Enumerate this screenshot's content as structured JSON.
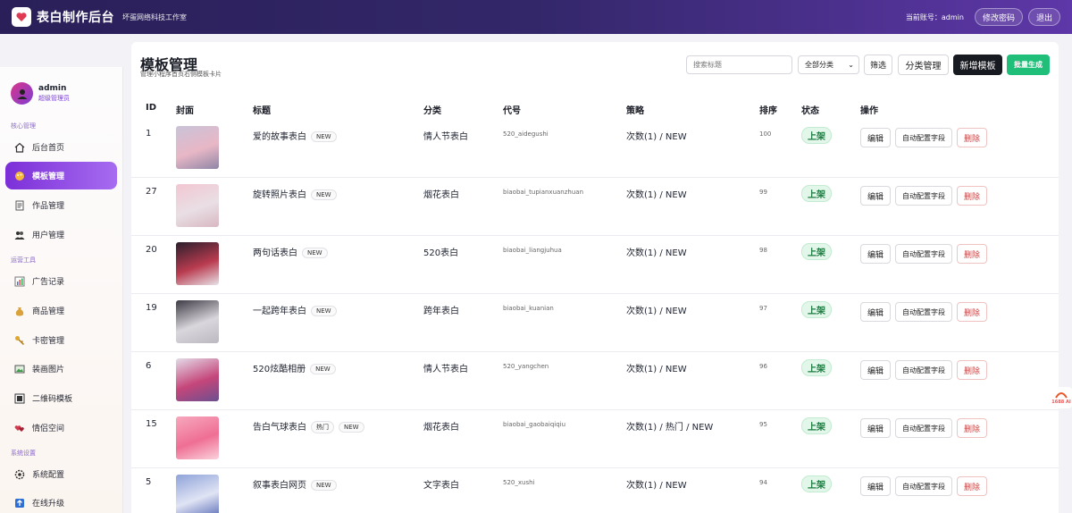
{
  "header": {
    "brand": "表白制作后台",
    "subbrand": "坏蛋网络科技工作室",
    "account_label": "当前账号：admin",
    "change_password": "修改密码",
    "logout": "退出"
  },
  "sidebar": {
    "user": {
      "name": "admin",
      "role": "超级管理员"
    },
    "sections": {
      "core": "核心管理",
      "ops": "运营工具",
      "sys": "系统设置"
    },
    "items": [
      {
        "label": "后台首页",
        "icon": "home-icon"
      },
      {
        "label": "模板管理",
        "icon": "heart-palette-icon",
        "active": true
      },
      {
        "label": "作品管理",
        "icon": "document-icon"
      },
      {
        "label": "用户管理",
        "icon": "users-icon"
      },
      {
        "label": "广告记录",
        "icon": "bar-chart-icon"
      },
      {
        "label": "商品管理",
        "icon": "money-bag-icon"
      },
      {
        "label": "卡密管理",
        "icon": "key-icon"
      },
      {
        "label": "装画图片",
        "icon": "picture-icon"
      },
      {
        "label": "二维码模板",
        "icon": "qrcode-icon"
      },
      {
        "label": "情侣空间",
        "icon": "couple-icon"
      },
      {
        "label": "系统配置",
        "icon": "gear-icon"
      },
      {
        "label": "在线升级",
        "icon": "upgrade-icon"
      }
    ]
  },
  "page": {
    "title": "模板管理",
    "subtitle": "管理小程序首页右侧模板卡片",
    "search_placeholder": "搜索标题",
    "category_select": "全部分类",
    "filter": "筛选",
    "category_manage": "分类管理",
    "new_template": "新增模板",
    "batch_generate": "批量生成"
  },
  "table": {
    "headers": [
      "ID",
      "封面",
      "标题",
      "分类",
      "代号",
      "策略",
      "排序",
      "状态",
      "操作"
    ],
    "actions": {
      "edit": "编辑",
      "auto": "自动配置字段",
      "delete": "删除"
    },
    "rows": [
      {
        "id": "1",
        "title": "爱的故事表白",
        "tags": [
          "NEW"
        ],
        "category": "情人节表白",
        "code": "520_aidegushi",
        "strategy": "次数(1) / NEW",
        "sort": "100",
        "status": "上架",
        "thumb": [
          "#c9c3d8",
          "#e8b7c6",
          "#8f86a6"
        ]
      },
      {
        "id": "27",
        "title": "旋转照片表白",
        "tags": [
          "NEW"
        ],
        "category": "烟花表白",
        "code": "biaobai_tupianxuanzhuan",
        "strategy": "次数(1) / NEW",
        "sort": "99",
        "status": "上架",
        "thumb": [
          "#f2c6d2",
          "#e9dfe4",
          "#d8b7c2"
        ]
      },
      {
        "id": "20",
        "title": "两句话表白",
        "tags": [
          "NEW"
        ],
        "category": "520表白",
        "code": "biaobai_liangjuhua",
        "strategy": "次数(1) / NEW",
        "sort": "98",
        "status": "上架",
        "thumb": [
          "#2a1f2c",
          "#b93b4f",
          "#e7e3e8"
        ]
      },
      {
        "id": "19",
        "title": "一起跨年表白",
        "tags": [
          "NEW"
        ],
        "category": "跨年表白",
        "code": "biaobai_kuanian",
        "strategy": "次数(1) / NEW",
        "sort": "97",
        "status": "上架",
        "thumb": [
          "#3d3a44",
          "#d9d6dc",
          "#bcb8c1"
        ]
      },
      {
        "id": "6",
        "title": "520炫酷相册",
        "tags": [
          "NEW"
        ],
        "category": "情人节表白",
        "code": "520_yangchen",
        "strategy": "次数(1) / NEW",
        "sort": "96",
        "status": "上架",
        "thumb": [
          "#e4dbe8",
          "#c5467a",
          "#6b4f8f"
        ]
      },
      {
        "id": "15",
        "title": "告白气球表白",
        "tags": [
          "热门",
          "NEW"
        ],
        "category": "烟花表白",
        "code": "biaobai_gaobaiqiqiu",
        "strategy": "次数(1) / 热门 / NEW",
        "sort": "95",
        "status": "上架",
        "thumb": [
          "#f7a8be",
          "#ef6f94",
          "#fbd2dd"
        ]
      },
      {
        "id": "5",
        "title": "叙事表白网页",
        "tags": [
          "NEW"
        ],
        "category": "文字表白",
        "code": "520_xushi",
        "strategy": "次数(1) / NEW",
        "sort": "94",
        "status": "上架",
        "thumb": [
          "#8fa3d9",
          "#e0e4f4",
          "#5b6eb8"
        ]
      }
    ]
  },
  "float_badge": "1688 AI"
}
